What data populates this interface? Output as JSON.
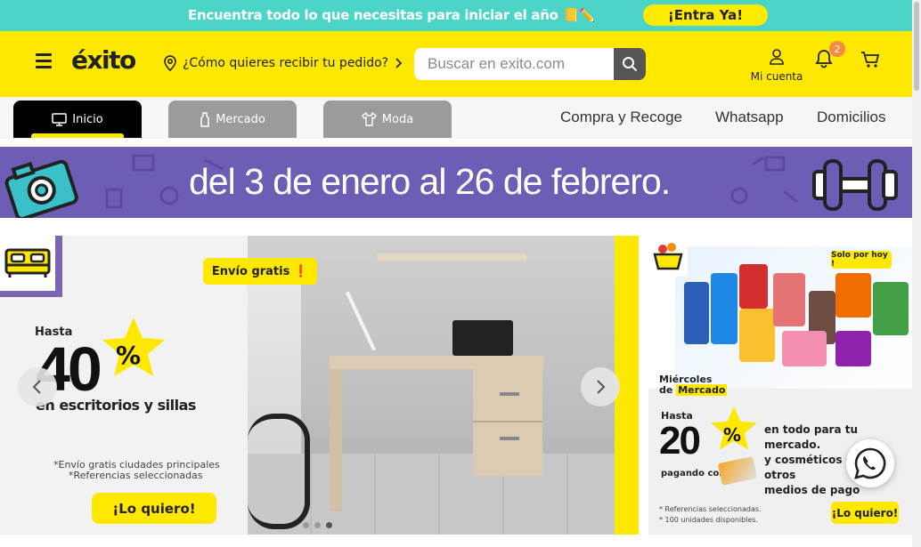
{
  "topbar": {
    "text": "Encuentra todo lo que necesitas para iniciar el año 📒✏️",
    "cta": "¡Entra Ya!"
  },
  "header": {
    "logo": "éxito",
    "delivery_prompt": "¿Cómo quieres recibir tu pedido?",
    "search_placeholder": "Buscar en exito.com",
    "account_label": "Mi cuenta",
    "notifications_count": "2"
  },
  "nav": {
    "tabs": [
      {
        "label": "Inicio",
        "active": true
      },
      {
        "label": "Mercado",
        "active": false
      },
      {
        "label": "Moda",
        "active": false
      }
    ],
    "links": [
      "Compra y Recoge",
      "Whatsapp",
      "Domicilios"
    ]
  },
  "promo_strip": {
    "text": "del 3 de enero al 26 de febrero."
  },
  "main_banner": {
    "envio": "Envío gratis ❗",
    "hasta": "Hasta",
    "percent": "40",
    "percent_sign": "%",
    "subtitle": "en escritorios y sillas",
    "note1": "*Envío gratis ciudades principales",
    "note2": "*Referencias seleccionadas",
    "cta": "¡Lo quiero!",
    "slide_count": 3,
    "active_slide": 2
  },
  "side_banner": {
    "badge": "Solo por hoy !",
    "day_line1": "Miércoles",
    "day_prefix": "de",
    "day_tag": "Mercado",
    "hasta": "Hasta",
    "percent": "20",
    "percent_sign": "%",
    "paying_with": "pagando con",
    "desc_line1": "en todo para tu mercado.",
    "desc_line2": "y cosméticos o 100 otros",
    "desc_line3": "medios de pago",
    "note1": "* Referencias seleccionadas.",
    "note2": "* 100 unidades disponibles.",
    "cta": "¡Lo quiero!"
  },
  "colors": {
    "brand_yellow": "#ffe800",
    "topbar_teal": "#4cd5c6",
    "promo_purple": "#6f5cb5",
    "badge_orange": "#f58a44"
  }
}
